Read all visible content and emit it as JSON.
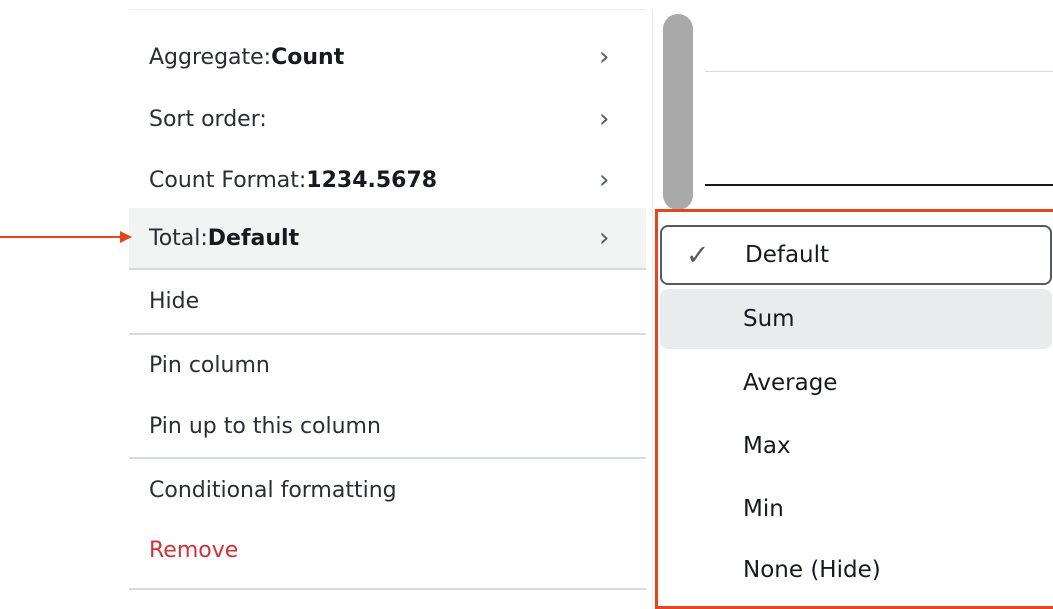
{
  "menu": {
    "items": [
      {
        "label": "Aggregate: ",
        "value": "Count",
        "chevron": "›"
      },
      {
        "label": "Sort order:",
        "value": "",
        "chevron": "›"
      },
      {
        "label": "Count Format: ",
        "value": "1234.5678",
        "chevron": "›"
      },
      {
        "label": "Total: ",
        "value": "Default",
        "chevron": "›"
      },
      {
        "label": "Hide"
      },
      {
        "label": "Pin column"
      },
      {
        "label": "Pin up to this column"
      },
      {
        "label": "Conditional formatting"
      },
      {
        "label": "Remove"
      }
    ]
  },
  "submenu": {
    "check_glyph": "✓",
    "options": [
      "Default",
      "Sum",
      "Average",
      "Max",
      "Min",
      "None (Hide)"
    ],
    "selected": "Default"
  },
  "colors": {
    "annotation": "#e8451e",
    "danger": "#d13239",
    "hover": "#e9ebed"
  }
}
